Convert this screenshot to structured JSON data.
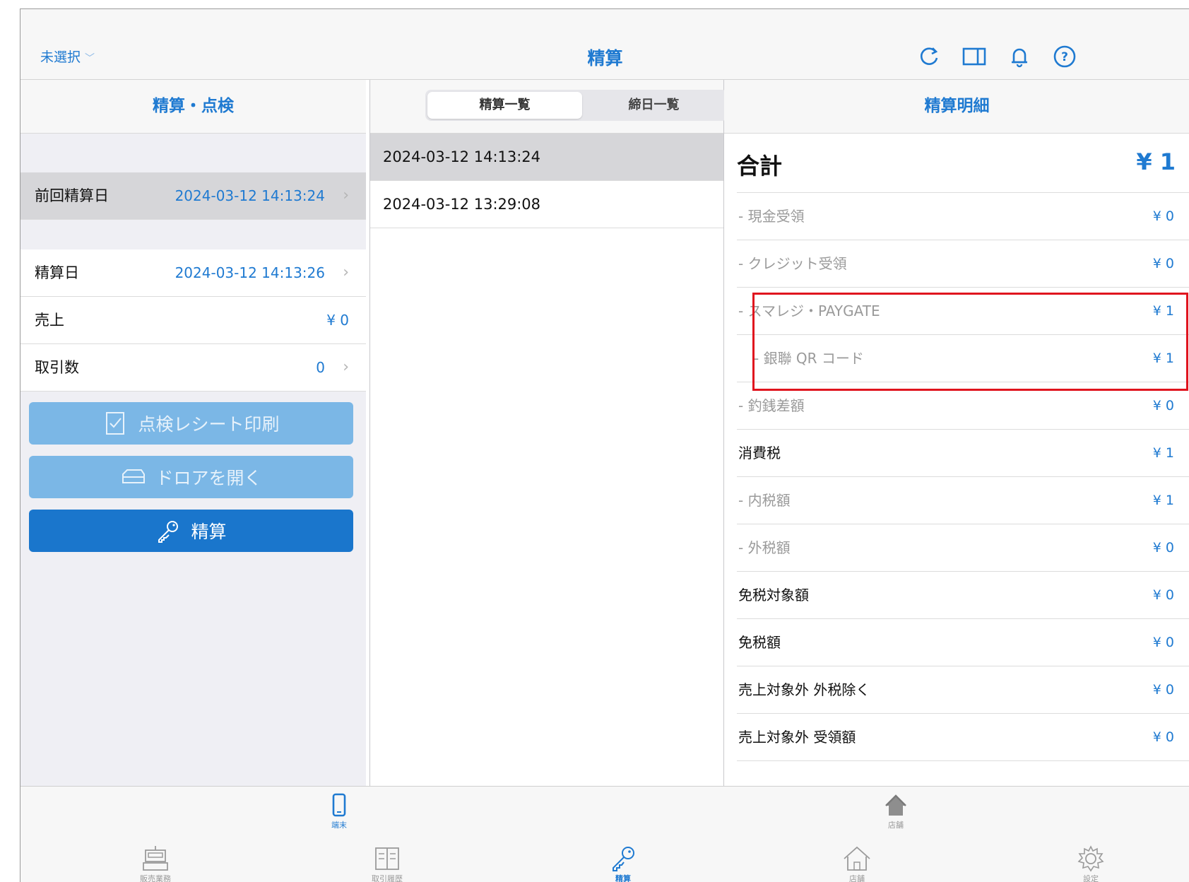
{
  "header": {
    "store_select": "未選択",
    "title": "精算",
    "icons": [
      "refresh-icon",
      "split-view-icon",
      "bell-icon",
      "help-icon"
    ]
  },
  "left": {
    "title": "精算・点検",
    "prev_settlement": {
      "label": "前回精算日",
      "value": "2024-03-12 14:13:24"
    },
    "rows": [
      {
        "label": "精算日",
        "value": "2024-03-12 14:13:26"
      },
      {
        "label": "売上",
        "value": "¥ 0"
      },
      {
        "label": "取引数",
        "value": "0"
      }
    ],
    "buttons": {
      "print_receipt": "点検レシート印刷",
      "open_drawer": "ドロアを開く",
      "settle": "精算"
    }
  },
  "middle": {
    "segments": {
      "active": "精算一覧",
      "inactive": "締日一覧"
    },
    "items": [
      "2024-03-12 14:13:24",
      "2024-03-12 13:29:08"
    ]
  },
  "right": {
    "title": "精算明細",
    "total": {
      "label": "合計",
      "value": "¥ 1"
    },
    "rows": [
      {
        "label": "- 現金受領",
        "value": "¥ 0"
      },
      {
        "label": "- クレジット受領",
        "value": "¥ 0"
      },
      {
        "label": "- スマレジ・PAYGATE",
        "value": "¥ 1"
      },
      {
        "label": "- 銀聯 QR コード",
        "value": "¥ 1"
      },
      {
        "label": "- 釣銭差額",
        "value": "¥ 0"
      },
      {
        "label": "消費税",
        "value": "¥ 1"
      },
      {
        "label": "- 内税額",
        "value": "¥ 1"
      },
      {
        "label": "- 外税額",
        "value": "¥ 0"
      },
      {
        "label": "免税対象額",
        "value": "¥ 0"
      },
      {
        "label": "免税額",
        "value": "¥ 0"
      },
      {
        "label": "売上対象外 外税除く",
        "value": "¥ 0"
      },
      {
        "label": "売上対象外 受領額",
        "value": "¥ 0"
      }
    ]
  },
  "scope_bar": {
    "terminal": "端末",
    "store": "店舗"
  },
  "tab_bar": {
    "sales": "販売業務",
    "history": "取引履歴",
    "settlement": "精算",
    "store": "店舗",
    "settings": "設定"
  },
  "colors": {
    "accent": "#1f7ad1",
    "highlight": "#e0141e"
  }
}
